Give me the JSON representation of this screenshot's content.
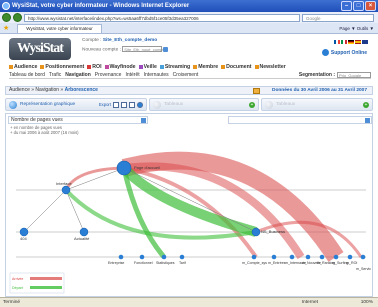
{
  "window": {
    "title": "WysiStat, votre cyber informateur - Windows Internet Explorer"
  },
  "address": {
    "url": "http://www.wysistat.net/interface/index.php?ws=ws5aa6ff7dbd5f1ce05f3d35ea327006",
    "search_placeholder": "Google"
  },
  "tab": {
    "label": "WysiStat, votre cyber informateur",
    "tools": "Page ▼  Outils ▼"
  },
  "account": {
    "label_compte": "Compte :",
    "compte": "Site_Eth_compte_demo",
    "label_nouveau": "Nouveau compte :",
    "nouveau": "Site_Eth_noué_compte"
  },
  "support": "Support Online",
  "logo": "WysiStat",
  "menu1": [
    {
      "label": "Audience",
      "color": "#e8941a"
    },
    {
      "label": "Positionnement",
      "color": "#e8941a"
    },
    {
      "label": "ROI",
      "color": "#d83a3a"
    },
    {
      "label": "Wayfinode",
      "color": "#c04aa0"
    },
    {
      "label": "Veille",
      "color": "#9c4ac0"
    },
    {
      "label": "Streaming",
      "color": "#4aa0d8"
    },
    {
      "label": "Membre",
      "color": "#e8941a"
    },
    {
      "label": "Document",
      "color": "#e8941a"
    },
    {
      "label": "Newsletter",
      "color": "#e8941a"
    }
  ],
  "menu2": [
    "Tableau de bord",
    "Trafic",
    "Navigation",
    "Provenance",
    "Intérêt",
    "Internautes",
    "Croisement"
  ],
  "menu2_active": "Navigation",
  "segmentation": {
    "label": "Segmentation :",
    "value": "Prio_Google"
  },
  "breadcrumb": {
    "prefix": "Audience »",
    "mid": "Navigation »",
    "current": "Arborescence"
  },
  "dates": "Données du 30 Avril 2006 au 31 Avril 2007",
  "toolbar": {
    "title": "Représentation graphique",
    "export": "Export",
    "disabled1": "Tableaux",
    "disabled2": "Tableaux"
  },
  "measure": "Nombre de pages vues",
  "legend_lines": [
    "+ en nombre de pages vues",
    "+ du mai 2006 à août 2007 (16 mois)"
  ],
  "nodes": [
    {
      "label": "Page d'accueil"
    },
    {
      "label": "Interface"
    },
    {
      "label": "404"
    },
    {
      "label": "Actualité"
    },
    {
      "label": "Entreprise"
    },
    {
      "label": "Fonctionnel"
    },
    {
      "label": "Statistiques"
    },
    {
      "label": "Tarif"
    },
    {
      "label": "NS_Business"
    },
    {
      "label": "m_Compte_sys"
    },
    {
      "label": "m_Entrées"
    },
    {
      "label": "m_Internaute"
    },
    {
      "label": "m_Nouvelle"
    },
    {
      "label": "m_Ranking"
    },
    {
      "label": "m_Surfing"
    },
    {
      "label": "m_ROI"
    },
    {
      "label": "m_Servic"
    }
  ],
  "mini_legend": {
    "row1": "Arrivée",
    "row2": "Départ"
  },
  "status": {
    "left": "Terminé",
    "zone": "Internet",
    "zoom": "100%"
  },
  "colors": {
    "in": "#d94545",
    "out": "#3fbf3a",
    "node": "#2a7fd4"
  }
}
